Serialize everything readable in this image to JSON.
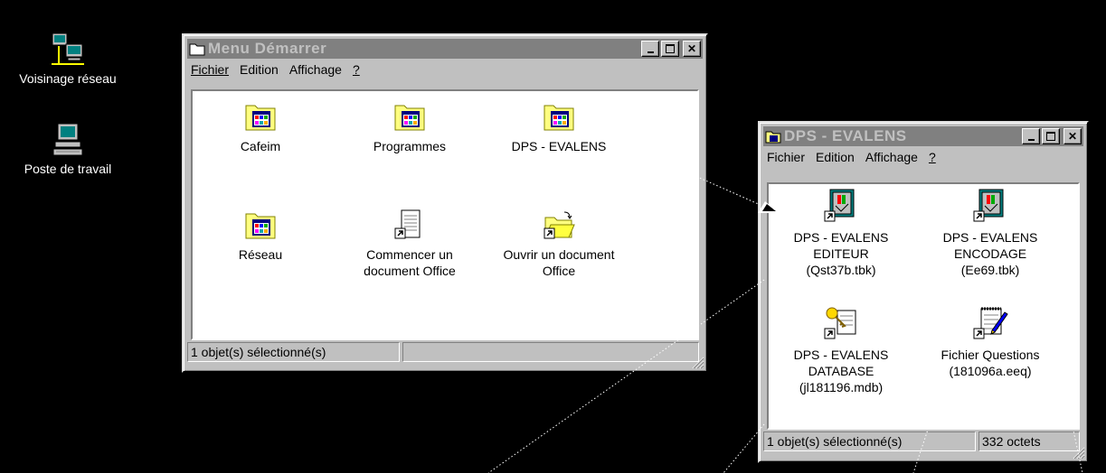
{
  "desktop": {
    "network": "Voisinage réseau",
    "computer": "Poste de travail"
  },
  "start_window": {
    "title": "Menu Démarrer",
    "menu": {
      "file": "Fichier",
      "edit": "Edition",
      "view": "Affichage",
      "help": "?"
    },
    "items": {
      "cafeim": "Cafeim",
      "programs": "Programmes",
      "dps": "DPS - EVALENS",
      "network": "Réseau",
      "new_doc_1": "Commencer un",
      "new_doc_2": "document Office",
      "open_doc_1": "Ouvrir un document",
      "open_doc_2": "Office"
    },
    "status": "1 objet(s) sélectionné(s)"
  },
  "dps_window": {
    "title": "DPS - EVALENS",
    "menu": {
      "file": "Fichier",
      "edit": "Edition",
      "view": "Affichage",
      "help": "?"
    },
    "items": {
      "editor_1": "DPS - EVALENS",
      "editor_2": "EDITEUR",
      "editor_3": "(Qst37b.tbk)",
      "encoding_1": "DPS - EVALENS",
      "encoding_2": "ENCODAGE",
      "encoding_3": "(Ee69.tbk)",
      "database_1": "DPS - EVALENS",
      "database_2": "DATABASE",
      "database_3": "(jl181196.mdb)",
      "questions_1": "Fichier Questions",
      "questions_2": "(181096a.eeq)"
    },
    "status": "1 objet(s) sélectionné(s)",
    "size": "332 octets"
  }
}
